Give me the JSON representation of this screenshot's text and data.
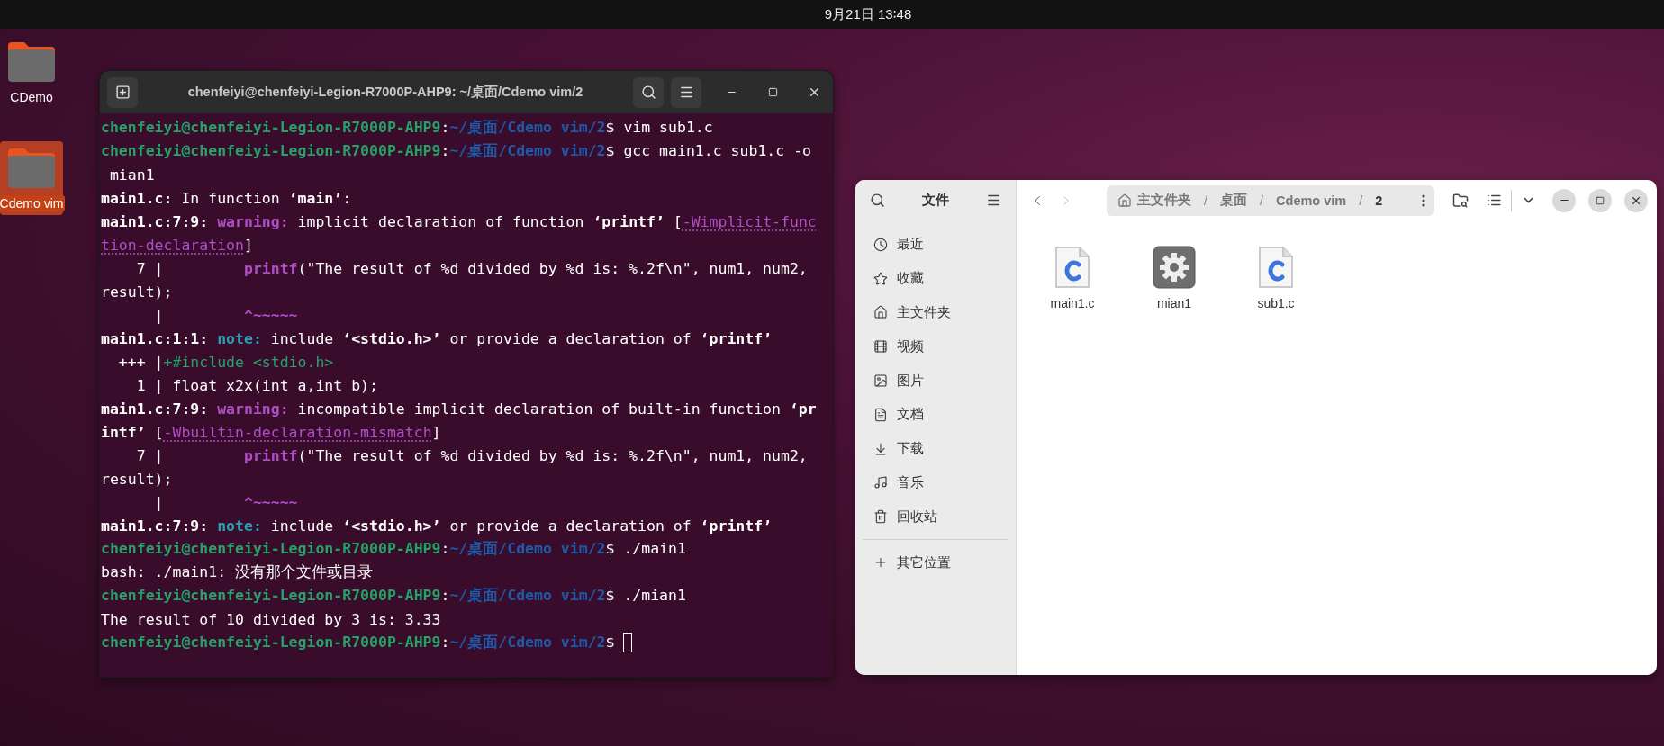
{
  "top_bar": {
    "clock": "9月21日 13∶48"
  },
  "desktop_icons": [
    {
      "label": "CDemo",
      "selected": false
    },
    {
      "label": "Cdemo vim",
      "selected": true
    }
  ],
  "terminal": {
    "title": "chenfeiyi@chenfeiyi-Legion-R7000P-AHP9: ~/桌面/Cdemo vim/2",
    "lines": [
      {
        "segments": [
          {
            "kind": "user",
            "text": "chenfeiyi@chenfeiyi-Legion-R7000P-AHP9"
          },
          {
            "kind": "plain",
            "text": ":"
          },
          {
            "kind": "path",
            "text": "~/桌面/Cdemo vim/2"
          },
          {
            "kind": "plain",
            "text": "$ vim sub1.c"
          }
        ]
      },
      {
        "segments": [
          {
            "kind": "user",
            "text": "chenfeiyi@chenfeiyi-Legion-R7000P-AHP9"
          },
          {
            "kind": "plain",
            "text": ":"
          },
          {
            "kind": "path",
            "text": "~/桌面/Cdemo vim/2"
          },
          {
            "kind": "plain",
            "text": "$ gcc main1.c sub1.c -o"
          }
        ]
      },
      {
        "segments": [
          {
            "kind": "plain",
            "text": " mian1"
          }
        ]
      },
      {
        "segments": [
          {
            "kind": "bold",
            "text": "main1.c:"
          },
          {
            "kind": "plain",
            "text": " In function "
          },
          {
            "kind": "bold",
            "text": "‘main’"
          },
          {
            "kind": "plain",
            "text": ":"
          }
        ]
      },
      {
        "segments": [
          {
            "kind": "bold",
            "text": "main1.c:7:9: "
          },
          {
            "kind": "warning",
            "text": "warning:"
          },
          {
            "kind": "plain",
            "text": " implicit declaration of function "
          },
          {
            "kind": "bold",
            "text": "‘printf’"
          },
          {
            "kind": "plain",
            "text": " ["
          },
          {
            "kind": "flag",
            "text": "-Wimplicit-func"
          }
        ]
      },
      {
        "segments": [
          {
            "kind": "flag",
            "text": "tion-declaration"
          },
          {
            "kind": "plain",
            "text": "]"
          }
        ]
      },
      {
        "segments": [
          {
            "kind": "plain",
            "text": "    7 |         "
          },
          {
            "kind": "highlight",
            "text": "printf"
          },
          {
            "kind": "plain",
            "text": "(\"The result of %d divided by %d is: %.2f\\n\", num1, num2,"
          }
        ]
      },
      {
        "segments": [
          {
            "kind": "plain",
            "text": "result);"
          }
        ]
      },
      {
        "segments": [
          {
            "kind": "plain",
            "text": "      |         "
          },
          {
            "kind": "caret",
            "text": "^~~~~~"
          }
        ]
      },
      {
        "segments": [
          {
            "kind": "bold",
            "text": "main1.c:1:1: "
          },
          {
            "kind": "note",
            "text": "note:"
          },
          {
            "kind": "plain",
            "text": " include "
          },
          {
            "kind": "bold",
            "text": "‘<stdio.h>’"
          },
          {
            "kind": "plain",
            "text": " or provide a declaration of "
          },
          {
            "kind": "bold",
            "text": "‘printf’"
          }
        ]
      },
      {
        "segments": [
          {
            "kind": "plain",
            "text": "  +++ |"
          },
          {
            "kind": "fixit",
            "text": "+#include <stdio.h>"
          }
        ]
      },
      {
        "segments": [
          {
            "kind": "plain",
            "text": "    1 | float x2x(int a,int b);"
          }
        ]
      },
      {
        "segments": [
          {
            "kind": "bold",
            "text": "main1.c:7:9: "
          },
          {
            "kind": "warning",
            "text": "warning:"
          },
          {
            "kind": "plain",
            "text": " incompatible implicit declaration of built-in function "
          },
          {
            "kind": "bold",
            "text": "‘pr"
          }
        ]
      },
      {
        "segments": [
          {
            "kind": "bold",
            "text": "intf’"
          },
          {
            "kind": "plain",
            "text": " ["
          },
          {
            "kind": "flag",
            "text": "-Wbuiltin-declaration-mismatch"
          },
          {
            "kind": "plain",
            "text": "]"
          }
        ]
      },
      {
        "segments": [
          {
            "kind": "plain",
            "text": "    7 |         "
          },
          {
            "kind": "highlight",
            "text": "printf"
          },
          {
            "kind": "plain",
            "text": "(\"The result of %d divided by %d is: %.2f\\n\", num1, num2,"
          }
        ]
      },
      {
        "segments": [
          {
            "kind": "plain",
            "text": "result);"
          }
        ]
      },
      {
        "segments": [
          {
            "kind": "plain",
            "text": "      |         "
          },
          {
            "kind": "caret",
            "text": "^~~~~~"
          }
        ]
      },
      {
        "segments": [
          {
            "kind": "bold",
            "text": "main1.c:7:9: "
          },
          {
            "kind": "note",
            "text": "note:"
          },
          {
            "kind": "plain",
            "text": " include "
          },
          {
            "kind": "bold",
            "text": "‘<stdio.h>’"
          },
          {
            "kind": "plain",
            "text": " or provide a declaration of "
          },
          {
            "kind": "bold",
            "text": "‘printf’"
          }
        ]
      },
      {
        "segments": [
          {
            "kind": "user",
            "text": "chenfeiyi@chenfeiyi-Legion-R7000P-AHP9"
          },
          {
            "kind": "plain",
            "text": ":"
          },
          {
            "kind": "path",
            "text": "~/桌面/Cdemo vim/2"
          },
          {
            "kind": "plain",
            "text": "$ ./main1"
          }
        ]
      },
      {
        "segments": [
          {
            "kind": "plain",
            "text": "bash: ./main1: 没有那个文件或目录"
          }
        ]
      },
      {
        "segments": [
          {
            "kind": "user",
            "text": "chenfeiyi@chenfeiyi-Legion-R7000P-AHP9"
          },
          {
            "kind": "plain",
            "text": ":"
          },
          {
            "kind": "path",
            "text": "~/桌面/Cdemo vim/2"
          },
          {
            "kind": "plain",
            "text": "$ ./mian1"
          }
        ]
      },
      {
        "segments": [
          {
            "kind": "plain",
            "text": "The result of 10 divided by 3 is: 3.33"
          }
        ]
      },
      {
        "segments": [
          {
            "kind": "user",
            "text": "chenfeiyi@chenfeiyi-Legion-R7000P-AHP9"
          },
          {
            "kind": "plain",
            "text": ":"
          },
          {
            "kind": "path",
            "text": "~/桌面/Cdemo vim/2"
          },
          {
            "kind": "plain",
            "text": "$ "
          }
        ],
        "cursor": true
      }
    ]
  },
  "file_manager": {
    "title": "文件",
    "sidebar": {
      "items": [
        {
          "kind": "recent",
          "label": "最近",
          "selected": false
        },
        {
          "kind": "starred",
          "label": "收藏",
          "selected": false
        },
        {
          "kind": "home",
          "label": "主文件夹",
          "selected": false
        },
        {
          "kind": "videos",
          "label": "视频",
          "selected": false
        },
        {
          "kind": "pictures",
          "label": "图片",
          "selected": false
        },
        {
          "kind": "documents",
          "label": "文档",
          "selected": false
        },
        {
          "kind": "downloads",
          "label": "下载",
          "selected": false
        },
        {
          "kind": "music",
          "label": "音乐",
          "selected": false
        },
        {
          "kind": "trash",
          "label": "回收站",
          "selected": false
        }
      ],
      "other": {
        "label": "其它位置"
      }
    },
    "nav": {
      "back_disabled": false,
      "forward_disabled": true
    },
    "path": [
      {
        "label": "主文件夹",
        "kind": "home",
        "selected": false
      },
      {
        "separator": "/",
        "label": "桌面",
        "kind": "folder",
        "selected": false
      },
      {
        "separator": "/",
        "label": "Cdemo vim",
        "kind": "folder",
        "selected": false
      },
      {
        "separator": "/",
        "label": "2",
        "kind": "folder",
        "selected": true
      }
    ],
    "files": [
      {
        "name": "main1.c",
        "kind": "c-source"
      },
      {
        "name": "mian1",
        "kind": "executable"
      },
      {
        "name": "sub1.c",
        "kind": "c-source"
      }
    ]
  }
}
